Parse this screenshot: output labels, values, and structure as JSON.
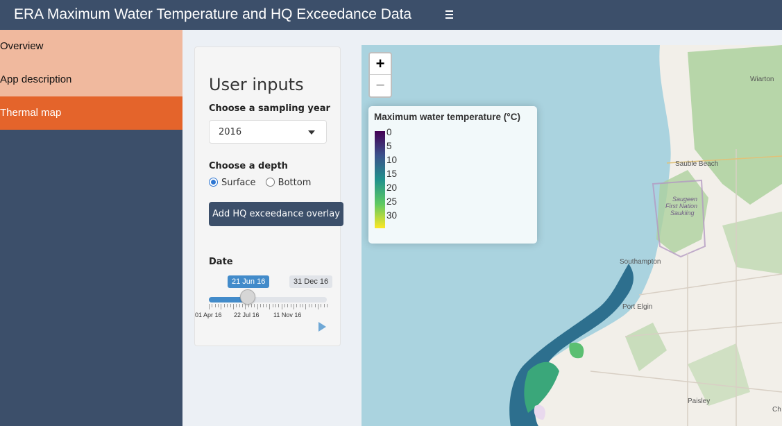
{
  "header": {
    "title": "ERA Maximum Water Temperature and HQ Exceedance Data",
    "menu_icon": "hamburger-icon"
  },
  "sidebar": {
    "items": [
      {
        "label": "Overview",
        "active": false
      },
      {
        "label": "App description",
        "active": false
      },
      {
        "label": "Thermal map",
        "active": true
      }
    ]
  },
  "panel": {
    "title": "User inputs",
    "year_label": "Choose a sampling year",
    "year_value": "2016",
    "depth_label": "Choose a depth",
    "depth_options": [
      {
        "label": "Surface",
        "selected": true
      },
      {
        "label": "Bottom",
        "selected": false
      }
    ],
    "overlay_button": "Add HQ exceedance overlay",
    "date_label": "Date",
    "slider": {
      "from_label": "21 Jun 16",
      "to_label": "31 Dec 16",
      "position_fraction": 0.33,
      "tick_labels": [
        "01 Apr 16",
        "22 Jul 16",
        "11 Nov 16"
      ]
    }
  },
  "map": {
    "zoom_in": "+",
    "zoom_out": "−",
    "legend": {
      "title": "Maximum water temperature (°C)",
      "labels": [
        "0",
        "5",
        "10",
        "15",
        "20",
        "25",
        "30"
      ]
    },
    "places": {
      "wiarton": "Wiarton",
      "sauble": "Sauble Beach",
      "saugeen1": "Saugeen",
      "saugeen2": "First Nation",
      "saugeen3": "Saukiing",
      "southampton": "Southampton",
      "port_elgin": "Port Elgin",
      "paisley": "Paisley",
      "ch": "Ch"
    },
    "colors": {
      "water": "#aad3df",
      "land": "#f2efe9",
      "forest": "#add19e"
    }
  }
}
